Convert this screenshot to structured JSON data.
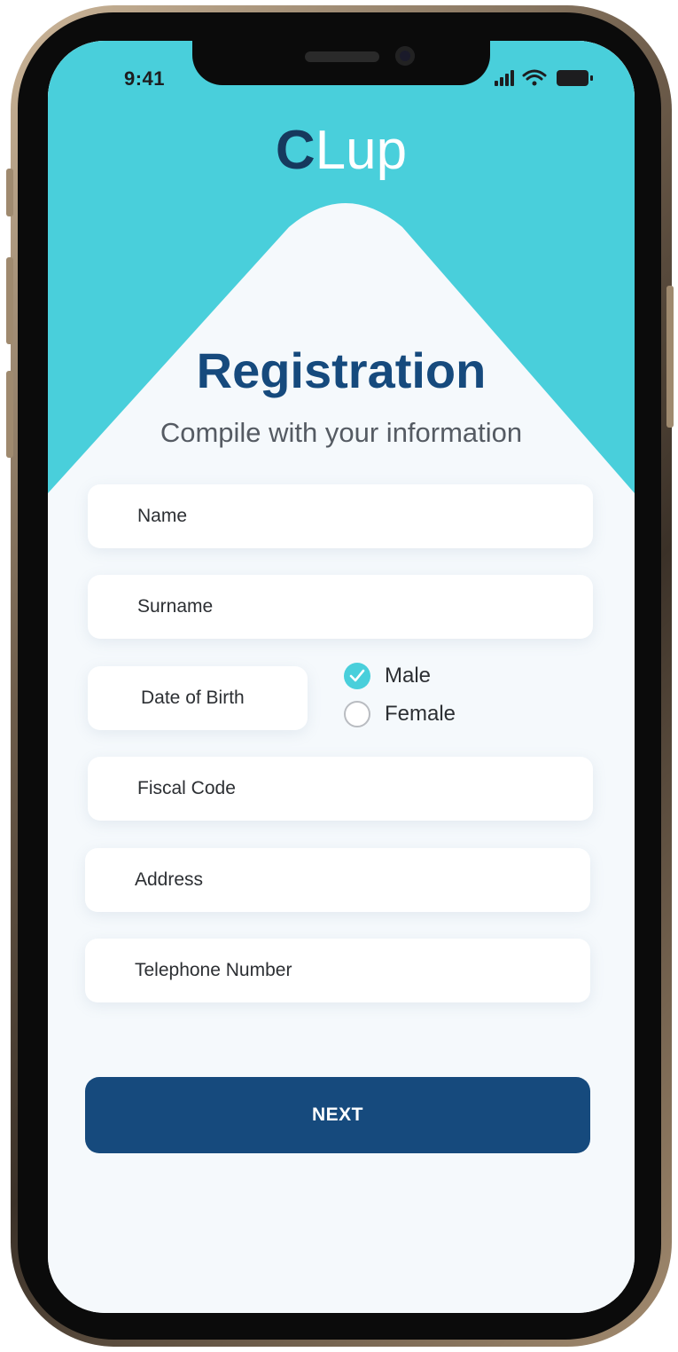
{
  "status_bar": {
    "time": "9:41",
    "icons": [
      "signal-icon",
      "wifi-icon",
      "battery-icon"
    ]
  },
  "logo": {
    "initial": "C",
    "rest": "Lup"
  },
  "header": {
    "title": "Registration",
    "subtitle": "Compile with your information"
  },
  "form": {
    "name_placeholder": "Name",
    "surname_placeholder": "Surname",
    "dob_placeholder": "Date of Birth",
    "gender": {
      "options": [
        {
          "label": "Male",
          "selected": true
        },
        {
          "label": "Female",
          "selected": false
        }
      ]
    },
    "fiscal_code_placeholder": "Fiscal Code",
    "address_placeholder": "Address",
    "telephone_placeholder": "Telephone Number"
  },
  "next_button": {
    "label": "NEXT"
  },
  "colors": {
    "accent_teal": "#49cfdb",
    "primary_blue": "#164a7d",
    "logo_dark": "#16395d",
    "card_background": "#f5f9fc"
  }
}
